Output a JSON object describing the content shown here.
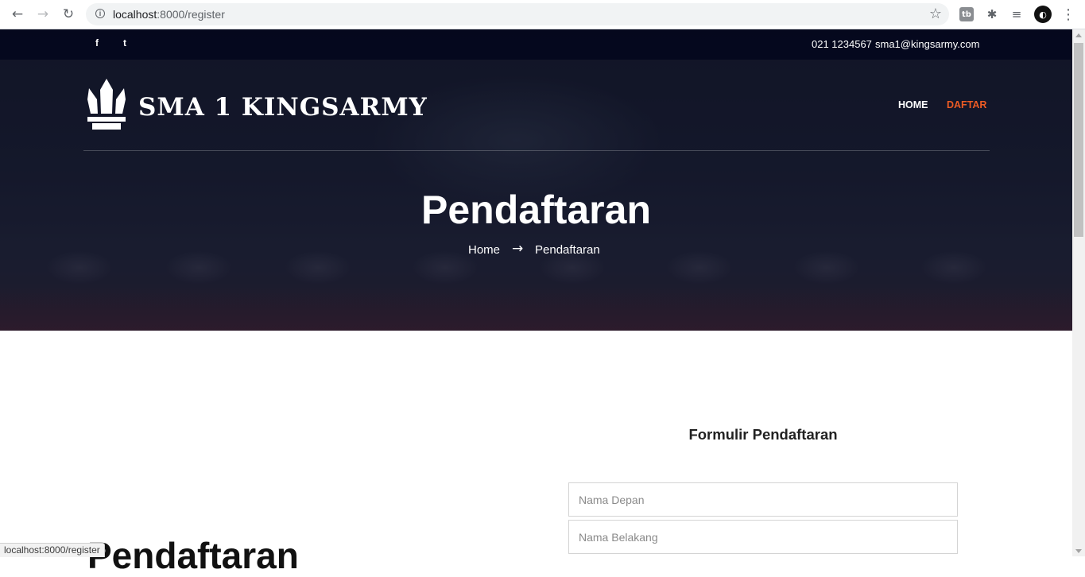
{
  "browser": {
    "url_host": "localhost",
    "url_rest": ":8000/register",
    "back_icon": "←",
    "forward_icon": "→",
    "reload_icon": "↻",
    "star_icon": "☆",
    "ext_badge": "tb",
    "ext_puzzle": "✱",
    "ext_media": "≡",
    "profile_glyph": "◐",
    "menu_icon": "⋮"
  },
  "topbar": {
    "facebook": "f",
    "twitter": "t",
    "phone": "021 1234567",
    "email": "sma1@kingsarmy.com"
  },
  "site": {
    "name": "SMA 1 KINGSARMY",
    "nav": {
      "home": "HOME",
      "daftar": "DAFTAR"
    },
    "accent": "#ec5b24"
  },
  "hero": {
    "title": "Pendaftaran",
    "breadcrumb_home": "Home",
    "breadcrumb_arrow": "→",
    "breadcrumb_current": "Pendaftaran"
  },
  "form": {
    "title": "Formulir Pendaftaran",
    "first_name_placeholder": "Nama Depan",
    "last_name_placeholder": "Nama Belakang"
  },
  "content": {
    "section_heading": "Pendaftaran"
  },
  "status_bar": {
    "url": "localhost:8000/register"
  }
}
